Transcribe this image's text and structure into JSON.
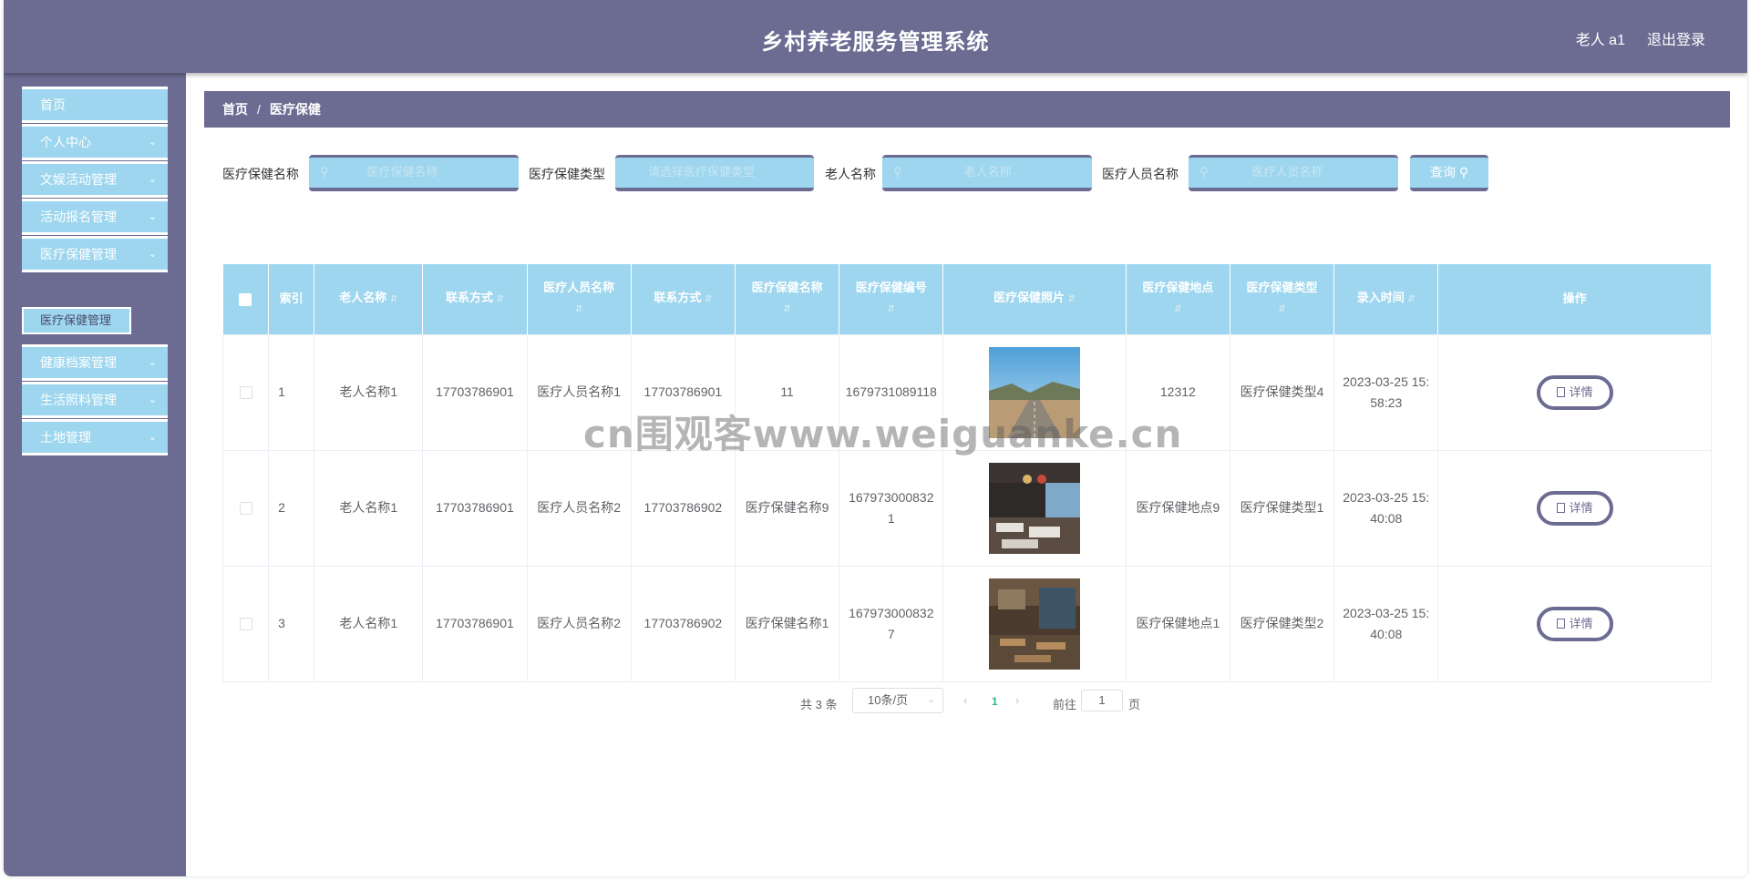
{
  "header": {
    "title": "乡村养老服务管理系统",
    "user": "老人 a1",
    "logout": "退出登录"
  },
  "sidebar": {
    "items": [
      {
        "label": "首页"
      },
      {
        "label": "个人中心"
      },
      {
        "label": "文娱活动管理"
      },
      {
        "label": "活动报名管理"
      },
      {
        "label": "医疗保健管理"
      },
      {
        "label": "健康档案管理"
      },
      {
        "label": "生活照料管理"
      },
      {
        "label": "土地管理"
      }
    ],
    "submenu": {
      "label": "医疗保健管理"
    }
  },
  "breadcrumb": {
    "home": "首页",
    "separator": "/",
    "current": "医疗保健"
  },
  "filters": {
    "name_label": "医疗保健名称",
    "name_placeholder": "医疗保健名称",
    "type_label": "医疗保健类型",
    "type_placeholder": "请选择医疗保健类型",
    "elder_label": "老人名称",
    "elder_placeholder": "老人名称",
    "staff_label": "医疗人员名称",
    "staff_placeholder": "医疗人员名称",
    "query_button": "查询"
  },
  "table": {
    "headers": {
      "index": "索引",
      "elder_name": "老人名称",
      "contact1": "联系方式",
      "staff_name": "医疗人员名称",
      "contact2": "联系方式",
      "care_name": "医疗保健名称",
      "care_code": "医疗保健编号",
      "photo": "医疗保健照片",
      "location": "医疗保健地点",
      "care_type": "医疗保健类型",
      "entry_time": "录入时间",
      "actions": "操作"
    },
    "rows": [
      {
        "index": "1",
        "elder_name": "老人名称1",
        "contact1": "17703786901",
        "staff_name": "医疗人员名称1",
        "contact2": "17703786901",
        "care_name": "11",
        "care_code": "1679731089118",
        "location": "12312",
        "care_type": "医疗保健类型4",
        "entry_time": "2023-03-25 15:58:23",
        "detail": "详情"
      },
      {
        "index": "2",
        "elder_name": "老人名称1",
        "contact1": "17703786901",
        "staff_name": "医疗人员名称2",
        "contact2": "17703786902",
        "care_name": "医疗保健名称9",
        "care_code": "1679730008321",
        "location": "医疗保健地点9",
        "care_type": "医疗保健类型1",
        "entry_time": "2023-03-25 15:40:08",
        "detail": "详情"
      },
      {
        "index": "3",
        "elder_name": "老人名称1",
        "contact1": "17703786901",
        "staff_name": "医疗人员名称2",
        "contact2": "17703786902",
        "care_name": "医疗保健名称1",
        "care_code": "1679730008327",
        "location": "医疗保健地点1",
        "care_type": "医疗保健类型2",
        "entry_time": "2023-03-25 15:40:08",
        "detail": "详情"
      }
    ]
  },
  "pagination": {
    "total": "共 3 条",
    "page_size": "10条/页",
    "current_page": "1",
    "goto": "前往",
    "jump_value": "1",
    "page_word": "页"
  },
  "watermark": "cn围观客www.weiguanke.cn",
  "colors": {
    "primary": "#6c6b92",
    "accent": "#9dd6ee",
    "active_page": "#2cb58a"
  }
}
